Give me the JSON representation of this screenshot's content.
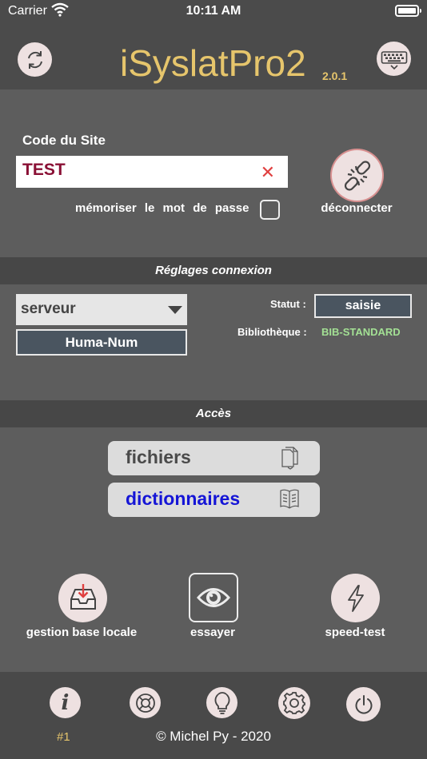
{
  "status_bar": {
    "carrier": "Carrier",
    "time": "10:11 AM"
  },
  "header": {
    "title": "iSyslatPro2",
    "version": "2.0.1"
  },
  "login": {
    "code_label": "Code du Site",
    "code_value": "TEST",
    "remember_label": "mémoriser le mot de passe",
    "disconnect_label": "déconnecter"
  },
  "settings": {
    "section_title": "Réglages connexion",
    "server_select": "serveur",
    "server_value": "Huma-Num",
    "status_label": "Statut :",
    "status_value": "saisie",
    "library_label": "Bibliothèque :",
    "library_value": "BIB-STANDARD"
  },
  "access": {
    "section_title": "Accès",
    "files_label": "fichiers",
    "dictionaries_label": "dictionnaires",
    "local_db_label": "gestion base locale",
    "try_label": "essayer",
    "speedtest_label": "speed-test"
  },
  "footer": {
    "number": "#1",
    "copyright": "© Michel Py - 2020"
  },
  "colors": {
    "accent_gold": "#e6c56c",
    "code_text": "#8a1035",
    "library_green": "#a3e094",
    "dictionaries_blue": "#1515d6",
    "icon_red": "#e04040"
  },
  "icons": [
    "refresh-icon",
    "keyboard-icon",
    "clear-icon",
    "broken-link-icon",
    "document-icon",
    "book-icon",
    "inbox-download-icon",
    "eye-icon",
    "lightning-icon",
    "info-icon",
    "lifebuoy-icon",
    "lightbulb-icon",
    "gear-icon",
    "power-icon"
  ]
}
